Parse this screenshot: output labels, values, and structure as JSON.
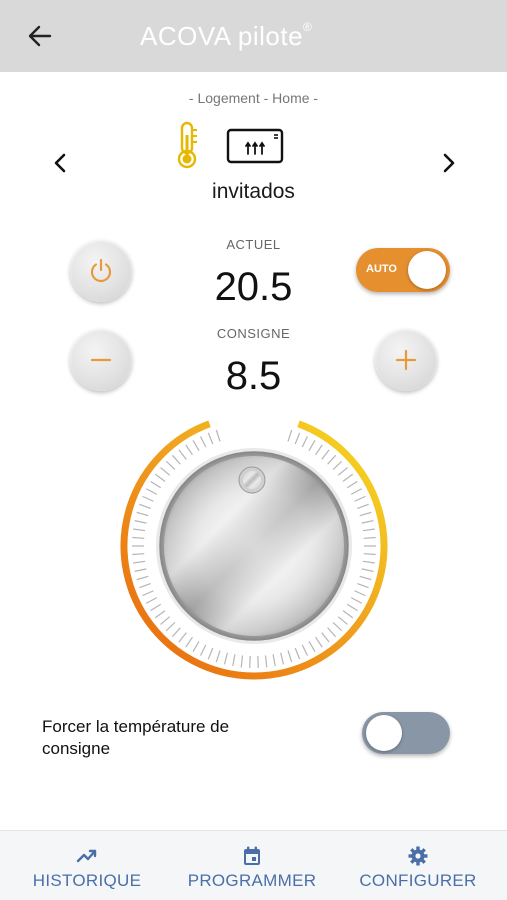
{
  "header": {
    "title": "ACOVA pilote",
    "title_mark": "®",
    "back_icon": "arrow-left-icon"
  },
  "breadcrumb": "- Logement - Home -",
  "device": {
    "name": "invitados",
    "icons": [
      "thermometer-icon",
      "radiator-icon"
    ]
  },
  "temperature": {
    "actuel_label": "ACTUEL",
    "actuel_value": "20.5",
    "consigne_label": "CONSIGNE",
    "consigne_value": "8.5"
  },
  "controls": {
    "auto_label": "AUTO",
    "auto_on": true
  },
  "force": {
    "label": "Forcer la température de consigne",
    "enabled": false
  },
  "bottom_nav": [
    {
      "label": "HISTORIQUE",
      "icon": "trending-up-icon"
    },
    {
      "label": "PROGRAMMER",
      "icon": "calendar-icon"
    },
    {
      "label": "CONFIGURER",
      "icon": "gear-icon"
    }
  ],
  "colors": {
    "accent": "#e58f2f",
    "header_bg": "#d9d9d9",
    "nav_text": "#4a6fa8",
    "toggle_off": "#8896a6"
  }
}
